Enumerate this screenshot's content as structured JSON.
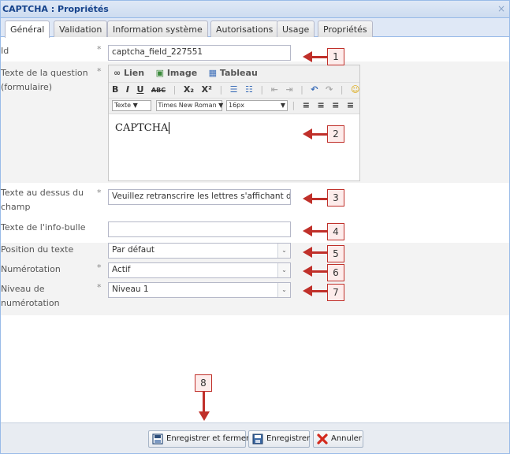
{
  "window": {
    "title": "CAPTCHA : Propriétés",
    "close_glyph": "×"
  },
  "tabs": [
    {
      "label": "Général"
    },
    {
      "label": "Validation"
    },
    {
      "label": "Information système"
    },
    {
      "label": "Autorisations"
    },
    {
      "label": "Usage"
    },
    {
      "label": "Propriétés"
    }
  ],
  "form": {
    "id": {
      "label": "Id",
      "required": "*",
      "value": "captcha_field_227551"
    },
    "question": {
      "label_line1": "Texte de la question",
      "label_line2": "(formulaire)",
      "required": "*"
    },
    "above": {
      "label_line1": "Texte au dessus du",
      "label_line2": "champ",
      "required": "*",
      "value": "Veuillez retranscrire les lettres s'affichant da"
    },
    "tooltip": {
      "label": "Texte de l'info-bulle",
      "value": ""
    },
    "position": {
      "label": "Position du texte",
      "value": "Par défaut"
    },
    "numbering": {
      "label": "Numérotation",
      "required": "*",
      "value": "Actif"
    },
    "level": {
      "label_line1": "Niveau de",
      "label_line2": "numérotation",
      "required": "*",
      "value": "Niveau 1"
    }
  },
  "editor": {
    "tabs": [
      "Lien",
      "Image",
      "Tableau"
    ],
    "format_select": "Texte",
    "font_select": "Times New Roman",
    "size_select": "16px",
    "content": "CAPTCHA"
  },
  "callouts": [
    "1",
    "2",
    "3",
    "4",
    "5",
    "6",
    "7",
    "8"
  ],
  "buttons": {
    "save_close": "Enregistrer et fermer",
    "save": "Enregistrer",
    "cancel": "Annuler"
  },
  "colors": {
    "accent": "#c0302a",
    "title": "#15428b"
  }
}
